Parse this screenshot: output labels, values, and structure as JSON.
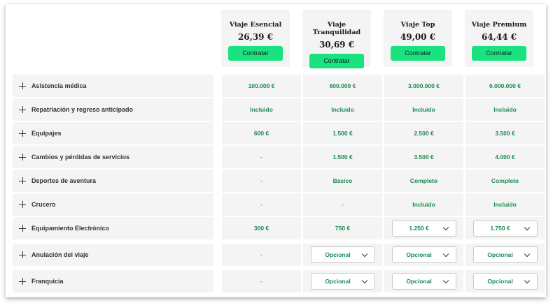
{
  "plans": [
    {
      "name": "Viaje Esencial",
      "price": "26,39 €",
      "button": "Contratar"
    },
    {
      "name": "Viaje Tranquilidad",
      "price": "30,69 €",
      "button": "Contratar"
    },
    {
      "name": "Viaje Top",
      "price": "49,00 €",
      "button": "Contratar"
    },
    {
      "name": "Viaje Premium",
      "price": "64,44 €",
      "button": "Contratar"
    }
  ],
  "rows": [
    {
      "label": "Asistencia médica",
      "values": [
        {
          "text": "100.000 €",
          "type": "text"
        },
        {
          "text": "600.000 €",
          "type": "text"
        },
        {
          "text": "3.000.000 €",
          "type": "text"
        },
        {
          "text": "6.000.000 €",
          "type": "text"
        }
      ]
    },
    {
      "label": "Repatriación y regreso anticipado",
      "values": [
        {
          "text": "Incluido",
          "type": "text"
        },
        {
          "text": "Incluido",
          "type": "text"
        },
        {
          "text": "Incluido",
          "type": "text"
        },
        {
          "text": "Incluido",
          "type": "text"
        }
      ]
    },
    {
      "label": "Equipajes",
      "values": [
        {
          "text": "600 €",
          "type": "text"
        },
        {
          "text": "1.500 €",
          "type": "text"
        },
        {
          "text": "2.500 €",
          "type": "text"
        },
        {
          "text": "3.500 €",
          "type": "text"
        }
      ]
    },
    {
      "label": "Cambios y pérdidas de servicios",
      "values": [
        {
          "text": "-",
          "type": "dash"
        },
        {
          "text": "1.500 €",
          "type": "text"
        },
        {
          "text": "3.500 €",
          "type": "text"
        },
        {
          "text": "4.000 €",
          "type": "text"
        }
      ]
    },
    {
      "label": "Deportes de aventura",
      "values": [
        {
          "text": "-",
          "type": "dash"
        },
        {
          "text": "Básico",
          "type": "text"
        },
        {
          "text": "Completo",
          "type": "text"
        },
        {
          "text": "Completo",
          "type": "text"
        }
      ]
    },
    {
      "label": "Crucero",
      "values": [
        {
          "text": "-",
          "type": "dash"
        },
        {
          "text": "-",
          "type": "dash"
        },
        {
          "text": "Incluido",
          "type": "text"
        },
        {
          "text": "Incluido",
          "type": "text"
        }
      ]
    },
    {
      "label": "Equipamiento Electrónico",
      "values": [
        {
          "text": "300 €",
          "type": "text"
        },
        {
          "text": "750 €",
          "type": "text"
        },
        {
          "text": "1.250 €",
          "type": "select"
        },
        {
          "text": "1.750 €",
          "type": "select"
        }
      ]
    },
    {
      "label": "Anulación del viaje",
      "values": [
        {
          "text": "-",
          "type": "dash"
        },
        {
          "text": "Opcional",
          "type": "select"
        },
        {
          "text": "Opcional",
          "type": "select"
        },
        {
          "text": "Opcional",
          "type": "select"
        }
      ]
    },
    {
      "label": "Franquicia",
      "values": [
        {
          "text": "-",
          "type": "dash"
        },
        {
          "text": "Opcional",
          "type": "select"
        },
        {
          "text": "Opcional",
          "type": "select"
        },
        {
          "text": "Opcional",
          "type": "select"
        }
      ]
    }
  ]
}
